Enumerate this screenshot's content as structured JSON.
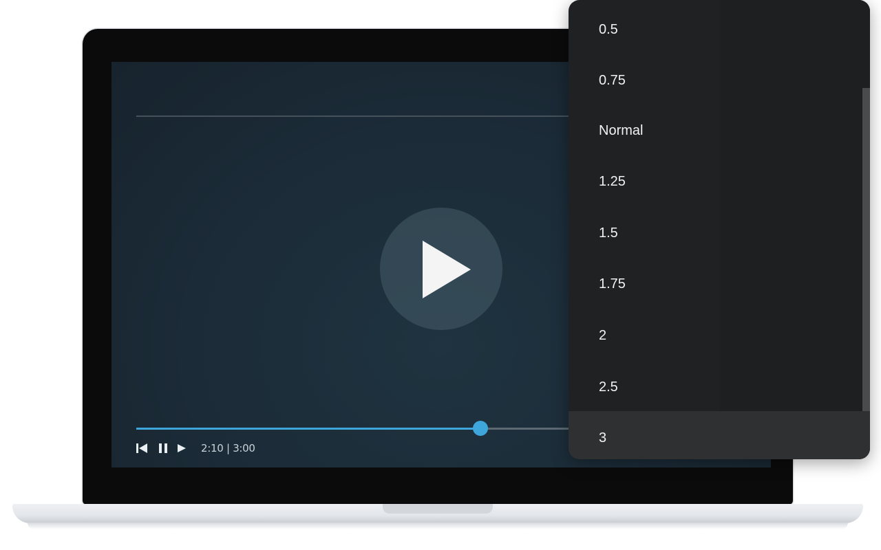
{
  "player": {
    "elapsed": "2:10",
    "separator": "|",
    "duration": "3:00",
    "progress_fraction": 0.556,
    "accent_color": "#3fa6dc"
  },
  "controls": {
    "icons": [
      "skip-back-icon",
      "pause-icon",
      "play-icon"
    ]
  },
  "speed_menu": {
    "options": [
      {
        "label": "0.5"
      },
      {
        "label": "0.75"
      },
      {
        "label": "Normal"
      },
      {
        "label": "1.25"
      },
      {
        "label": "1.5"
      },
      {
        "label": "1.75"
      },
      {
        "label": "2"
      },
      {
        "label": "2.5"
      },
      {
        "label": "3"
      }
    ],
    "highlighted_option": "3"
  }
}
